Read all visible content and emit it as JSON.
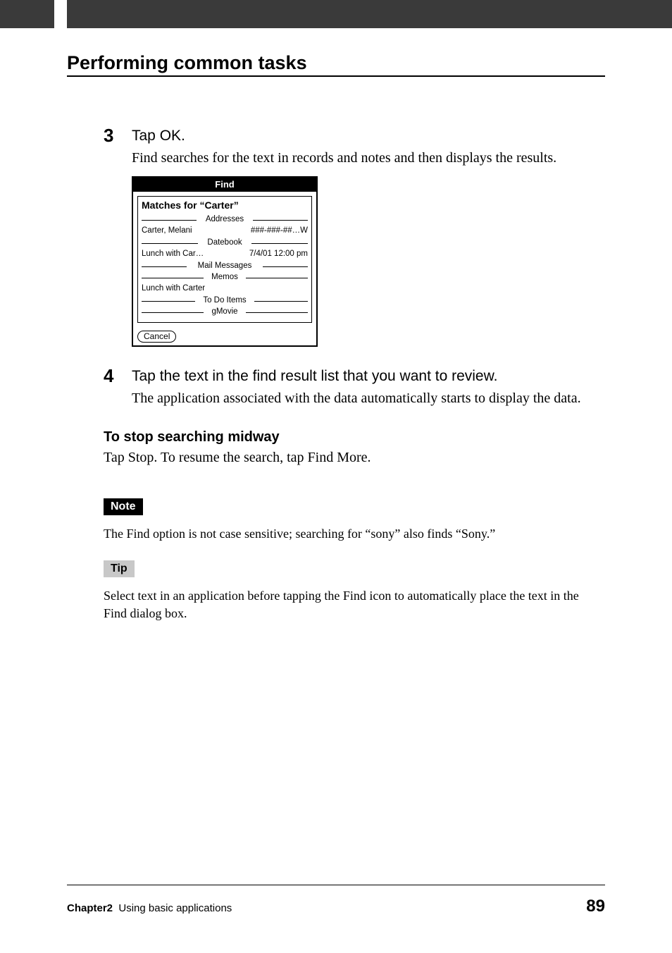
{
  "heading": "Performing common tasks",
  "steps": [
    {
      "num": "3",
      "title": "Tap OK.",
      "desc": "Find searches for the text in records and notes and then displays the results."
    },
    {
      "num": "4",
      "title": "Tap the text in the find result list that you want to review.",
      "desc": "The application associated with the data automatically starts to display the data."
    }
  ],
  "find_dialog": {
    "title": "Find",
    "matches_label": "Matches for “Carter”",
    "categories": {
      "addresses": "Addresses",
      "datebook": "Datebook",
      "mail": "Mail Messages",
      "memos": "Memos",
      "todo": "To Do Items",
      "gmovie": "gMovie"
    },
    "results": {
      "addresses_left": "Carter, Melani",
      "addresses_right": "###-###-##…W",
      "datebook_left": "Lunch with Car…",
      "datebook_right": "7/4/01 12:00 pm",
      "memos_left": "Lunch with Carter"
    },
    "cancel": "Cancel"
  },
  "sub": {
    "heading": "To stop searching midway",
    "desc": "Tap Stop. To resume the search, tap Find More."
  },
  "note": {
    "label": "Note",
    "text": "The Find option is not case sensitive; searching for “sony” also finds “Sony.”"
  },
  "tip": {
    "label": "Tip",
    "text": "Select text in an application before tapping the Find icon to automatically place the text in the Find dialog box."
  },
  "footer": {
    "chapter_bold": "Chapter2",
    "chapter_rest": "Using basic applications",
    "page": "89"
  }
}
